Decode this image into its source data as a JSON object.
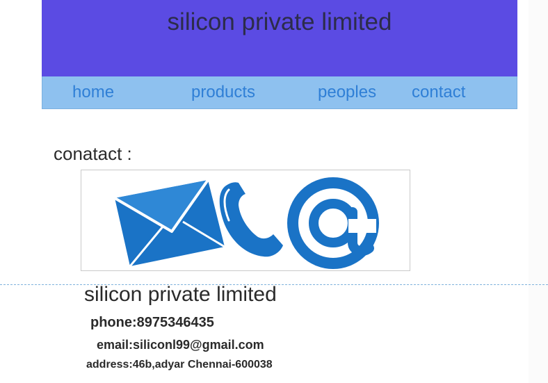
{
  "header": {
    "title": "silicon private limited",
    "background_color": "#5b4be3"
  },
  "nav": {
    "background_color": "#8ec1ef",
    "link_color": "#2f7fd6",
    "items": [
      {
        "label": "home"
      },
      {
        "label": "products"
      },
      {
        "label": "peoples"
      },
      {
        "label": "contact"
      }
    ]
  },
  "main": {
    "contact_heading": "conatact :",
    "contact_image": {
      "icons": [
        "envelope-icon",
        "phone-handset-icon",
        "at-sign-icon"
      ],
      "icon_color": "#1a73c6"
    }
  },
  "footer": {
    "company": "silicon private limited",
    "phone": "phone:8975346435",
    "email": "email:siliconl99@gmail.com",
    "address": "address:46b,adyar Chennai-600038"
  }
}
